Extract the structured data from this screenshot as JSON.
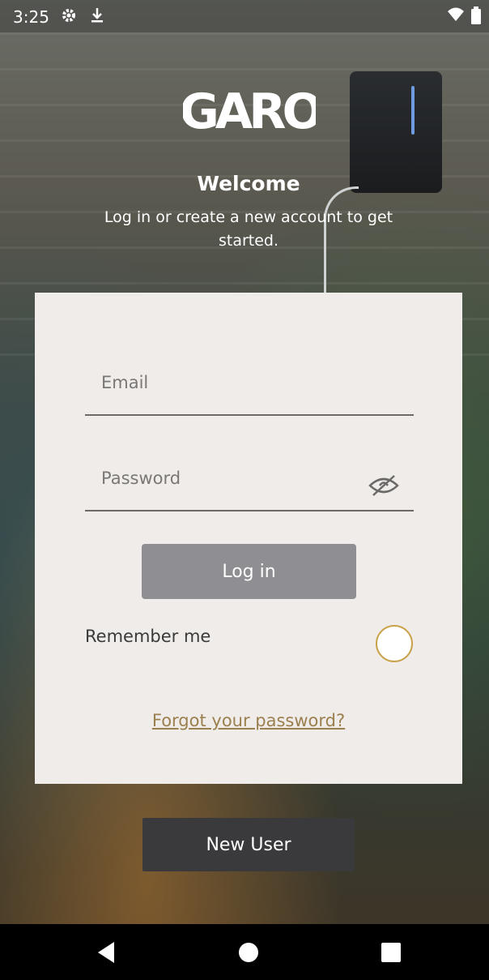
{
  "status_bar": {
    "time": "3:25",
    "icons": [
      "settings-icon",
      "download-icon",
      "wifi-icon",
      "battery-icon"
    ]
  },
  "brand": {
    "logo_text": "GARO"
  },
  "header": {
    "title": "Welcome",
    "subtitle": "Log in or create a new account to get started."
  },
  "login_form": {
    "email_placeholder": "Email",
    "email_value": "",
    "password_placeholder": "Password",
    "password_value": "",
    "password_visibility_icon": "eye-off-icon",
    "login_label": "Log in",
    "remember_label": "Remember me",
    "remember_checked": false,
    "forgot_label": "Forgot your password?"
  },
  "footer": {
    "new_user_label": "New User"
  },
  "nav": {
    "icons": [
      "back-icon",
      "home-icon",
      "recents-icon"
    ]
  },
  "colors": {
    "card_bg": "#efece9",
    "login_btn": "#8f8e93",
    "new_user_btn": "#3a3a3c",
    "accent_gold": "#c9a24a",
    "link": "#9c7f4e"
  }
}
